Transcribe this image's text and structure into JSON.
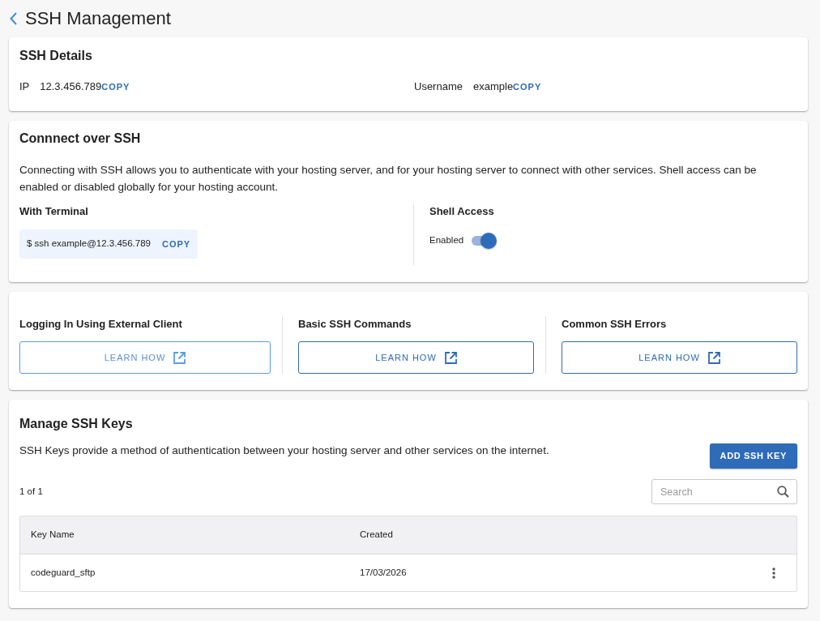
{
  "page": {
    "title": "SSH Management"
  },
  "ssh_details": {
    "title": "SSH Details",
    "fields": [
      {
        "label": "IP",
        "value": "12.3.456.789",
        "action": "COPY"
      },
      {
        "label": "Username",
        "value": "example",
        "action": "COPY"
      }
    ]
  },
  "connect": {
    "title": "Connnect over SSH",
    "description": "Connecting with SSH allows you to authenticate with your hosting server, and for your hosting server to connect with other services. Shell access can be enabled or disabled globally for your hosting account.",
    "terminal": {
      "title": "With Terminal",
      "command": "$ ssh example@12.3.456.789",
      "action": "COPY"
    },
    "shell_access": {
      "title": "Shell Access",
      "label": "Enabled",
      "on": true
    }
  },
  "guides": [
    {
      "title": "Logging In Using External Client",
      "button": "LEARN HOW",
      "highlighted": true
    },
    {
      "title": "Basic SSH Commands",
      "button": "LEARN HOW",
      "highlighted": false
    },
    {
      "title": "Common SSH Errors",
      "button": "LEARN HOW",
      "highlighted": false
    }
  ],
  "ssh_keys": {
    "title": "Manage SSH Keys",
    "description": "SSH Keys provide a method of authentication between your hosting server and other services on the internet.",
    "add_button": "ADD SSH KEY",
    "count": "1 of 1",
    "search": {
      "placeholder": "Search"
    },
    "table": {
      "columns": [
        "Key Name",
        "Created"
      ],
      "rows": [
        {
          "cells": [
            "codeguard_sftp",
            "17/03/2026"
          ]
        }
      ]
    }
  }
}
